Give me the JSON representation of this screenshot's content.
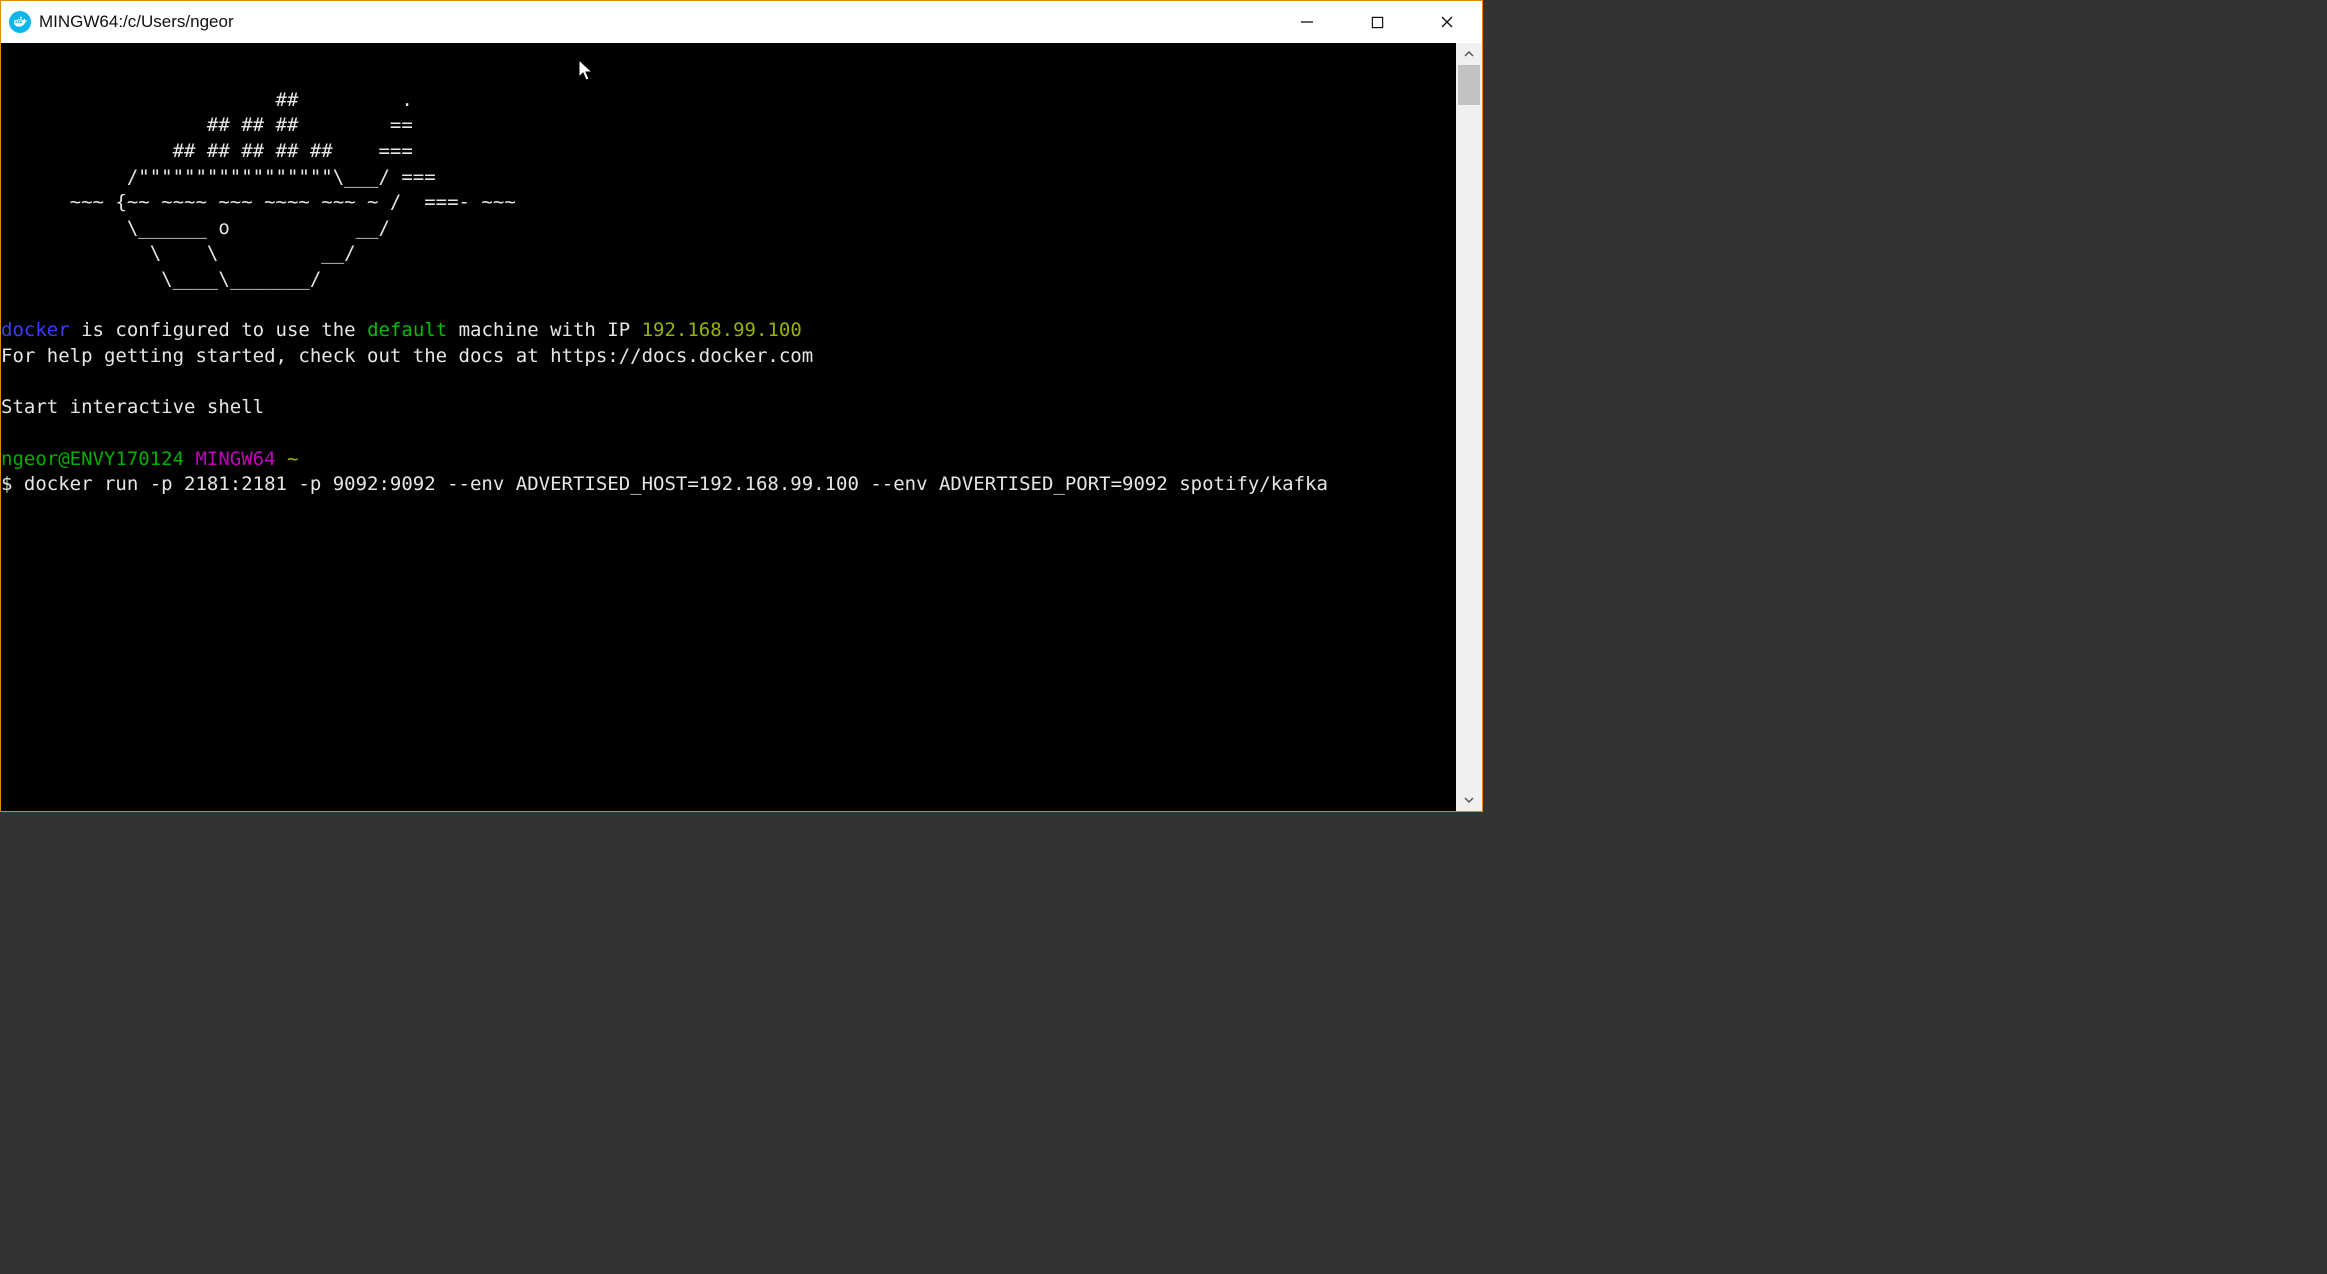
{
  "window": {
    "title": "MINGW64:/c/Users/ngeor"
  },
  "terminal": {
    "ascii_art": [
      "                        ##         .",
      "                  ## ## ##        ==",
      "               ## ## ## ## ##    ===",
      "           /\"\"\"\"\"\"\"\"\"\"\"\"\"\"\"\"\"\\___/ ===",
      "      ~~~ {~~ ~~~~ ~~~ ~~~~ ~~~ ~ /  ===- ~~~",
      "           \\______ o           __/",
      "             \\    \\         __/",
      "              \\____\\_______/"
    ],
    "msg_docker_word": "docker",
    "msg_configured_pre": " is configured to use the ",
    "msg_default_word": "default",
    "msg_configured_mid": " machine with IP ",
    "msg_ip": "192.168.99.100",
    "msg_help": "For help getting started, check out the docs at https://docs.docker.com",
    "msg_start_shell": "Start interactive shell",
    "prompt_userhost": "ngeor@ENVY170124",
    "prompt_space1": " ",
    "prompt_env": "MINGW64",
    "prompt_tilde": " ~",
    "cmd_prefix": "$ ",
    "cmd_line": "docker run -p 2181:2181 -p 9092:9092 --env ADVERTISED_HOST=192.168.99.100 --env ADVERTISED_PORT=9092 spotify/kafka"
  }
}
